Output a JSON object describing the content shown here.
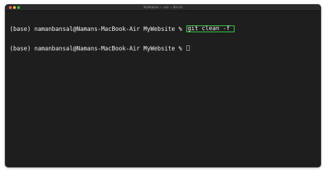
{
  "window": {
    "title": "MyWebsite — -zsh — 80×24",
    "background": "#1e1e1e",
    "text_color": "#f2f2f2"
  },
  "traffic_lights": {
    "close_color": "#ff5f57",
    "minimize_color": "#febc2e",
    "zoom_color": "#28c840"
  },
  "terminal": {
    "lines": [
      {
        "prompt": "(base) namanbansal@Namans-MacBook-Air MyWebsite % ",
        "command": "git clean -f"
      },
      {
        "prompt": "(base) namanbansal@Namans-MacBook-Air MyWebsite % ",
        "command": ""
      }
    ],
    "highlight_color": "#31d843"
  }
}
